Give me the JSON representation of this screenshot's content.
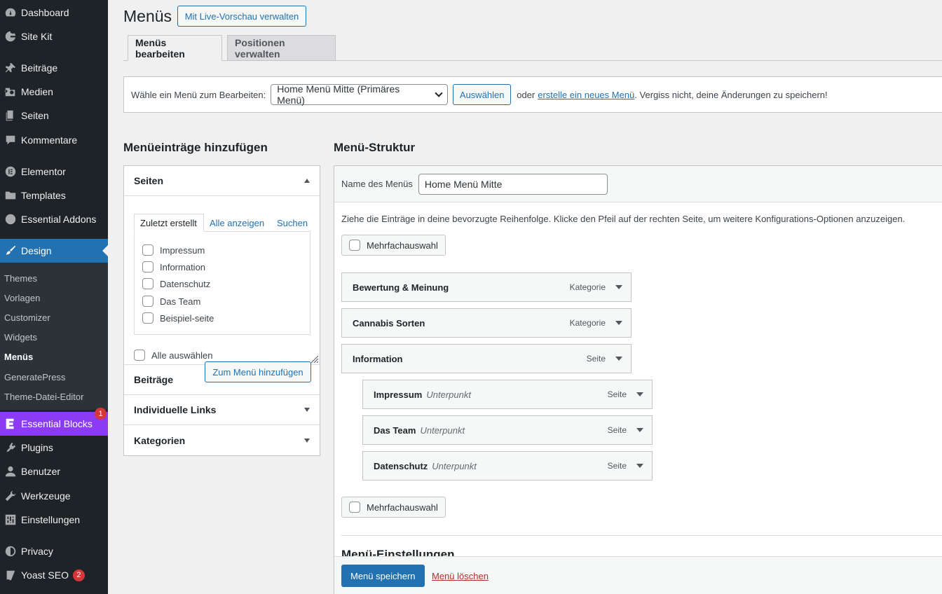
{
  "sidebar": {
    "items": [
      {
        "label": "Dashboard",
        "icon": "dashboard-icon"
      },
      {
        "label": "Site Kit",
        "icon": "sitekit-g-icon"
      },
      {
        "label": "Beiträge",
        "icon": "pin-icon"
      },
      {
        "label": "Medien",
        "icon": "media-icon"
      },
      {
        "label": "Seiten",
        "icon": "pages-icon"
      },
      {
        "label": "Kommentare",
        "icon": "comments-icon"
      },
      {
        "label": "Elementor",
        "icon": "elementor-icon"
      },
      {
        "label": "Templates",
        "icon": "folder-icon"
      },
      {
        "label": "Essential Addons",
        "icon": "ea-icon"
      },
      {
        "label": "Design",
        "icon": "brush-icon"
      },
      {
        "label": "Essential Blocks",
        "icon": "eb-icon",
        "badge": "1"
      },
      {
        "label": "Plugins",
        "icon": "plugin-icon"
      },
      {
        "label": "Benutzer",
        "icon": "user-icon"
      },
      {
        "label": "Werkzeuge",
        "icon": "wrench-icon"
      },
      {
        "label": "Einstellungen",
        "icon": "settings-icon"
      },
      {
        "label": "Privacy",
        "icon": "privacy-icon"
      },
      {
        "label": "Yoast SEO",
        "icon": "yoast-icon",
        "badge": "2"
      }
    ],
    "submenu": [
      "Themes",
      "Vorlagen",
      "Customizer",
      "Widgets",
      "Menüs",
      "GeneratePress",
      "Theme-Datei-Editor"
    ]
  },
  "header": {
    "title": "Menüs",
    "live_preview_button": "Mit Live-Vorschau verwalten"
  },
  "tabs": [
    "Menüs bearbeiten",
    "Positionen verwalten"
  ],
  "manage": {
    "label": "Wähle ein Menü zum Bearbeiten:",
    "selected_menu": "Home Menü Mitte (Primäres Menü)",
    "select_button": "Auswählen",
    "text_or": "oder",
    "create_link": "erstelle ein neues Menü",
    "text_reminder": ". Vergiss nicht, deine Änderungen zu speichern!"
  },
  "left": {
    "heading": "Menüeinträge hinzufügen",
    "sections": [
      "Seiten",
      "Beiträge",
      "Individuelle Links",
      "Kategorien"
    ],
    "page_tabs": [
      "Zuletzt erstellt",
      "Alle anzeigen",
      "Suchen"
    ],
    "pages": [
      "Impressum",
      "Information",
      "Datenschutz",
      "Das Team",
      "Beispiel-seite"
    ],
    "select_all": "Alle auswählen",
    "add_button": "Zum Menü hinzufügen"
  },
  "right": {
    "heading": "Menü-Struktur",
    "name_label": "Name des Menüs",
    "name_value": "Home Menü Mitte",
    "instructions": "Ziehe die Einträge in deine bevorzugte Reihenfolge. Klicke den Pfeil auf der rechten Seite, um weitere Konfigurations-Optionen anzuzeigen.",
    "bulk_select": "Mehrfachauswahl",
    "items": [
      {
        "title": "Bewertung & Meinung",
        "type": "Kategorie",
        "sub": ""
      },
      {
        "title": "Cannabis Sorten",
        "type": "Kategorie",
        "sub": ""
      },
      {
        "title": "Information",
        "type": "Seite",
        "sub": ""
      },
      {
        "title": "Impressum",
        "type": "Seite",
        "sub": "Unterpunkt"
      },
      {
        "title": "Das Team",
        "type": "Seite",
        "sub": "Unterpunkt"
      },
      {
        "title": "Datenschutz",
        "type": "Seite",
        "sub": "Unterpunkt"
      }
    ],
    "settings_heading": "Menü-Einstellungen",
    "save_button": "Menü speichern",
    "delete_link": "Menü löschen"
  }
}
